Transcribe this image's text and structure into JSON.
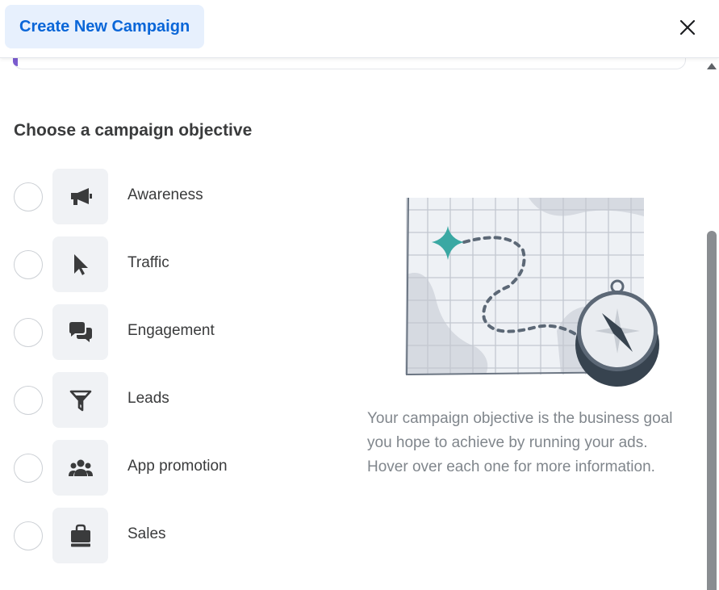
{
  "header": {
    "title": "Create New Campaign"
  },
  "section": {
    "title": "Choose a campaign objective"
  },
  "objectives": [
    {
      "label": "Awareness",
      "icon": "megaphone-icon"
    },
    {
      "label": "Traffic",
      "icon": "cursor-icon"
    },
    {
      "label": "Engagement",
      "icon": "chat-bubbles-icon"
    },
    {
      "label": "Leads",
      "icon": "funnel-icon"
    },
    {
      "label": "App promotion",
      "icon": "people-icon"
    },
    {
      "label": "Sales",
      "icon": "shopping-bag-icon"
    }
  ],
  "description": "Your campaign objective is the business goal you hope to achieve by running your ads. Hover over each one for more information.",
  "colors": {
    "accent": "#0a66d8",
    "tab_bg": "#e7f0fd",
    "teal": "#3aa8a3",
    "icon_dark": "#3a3b3c"
  }
}
